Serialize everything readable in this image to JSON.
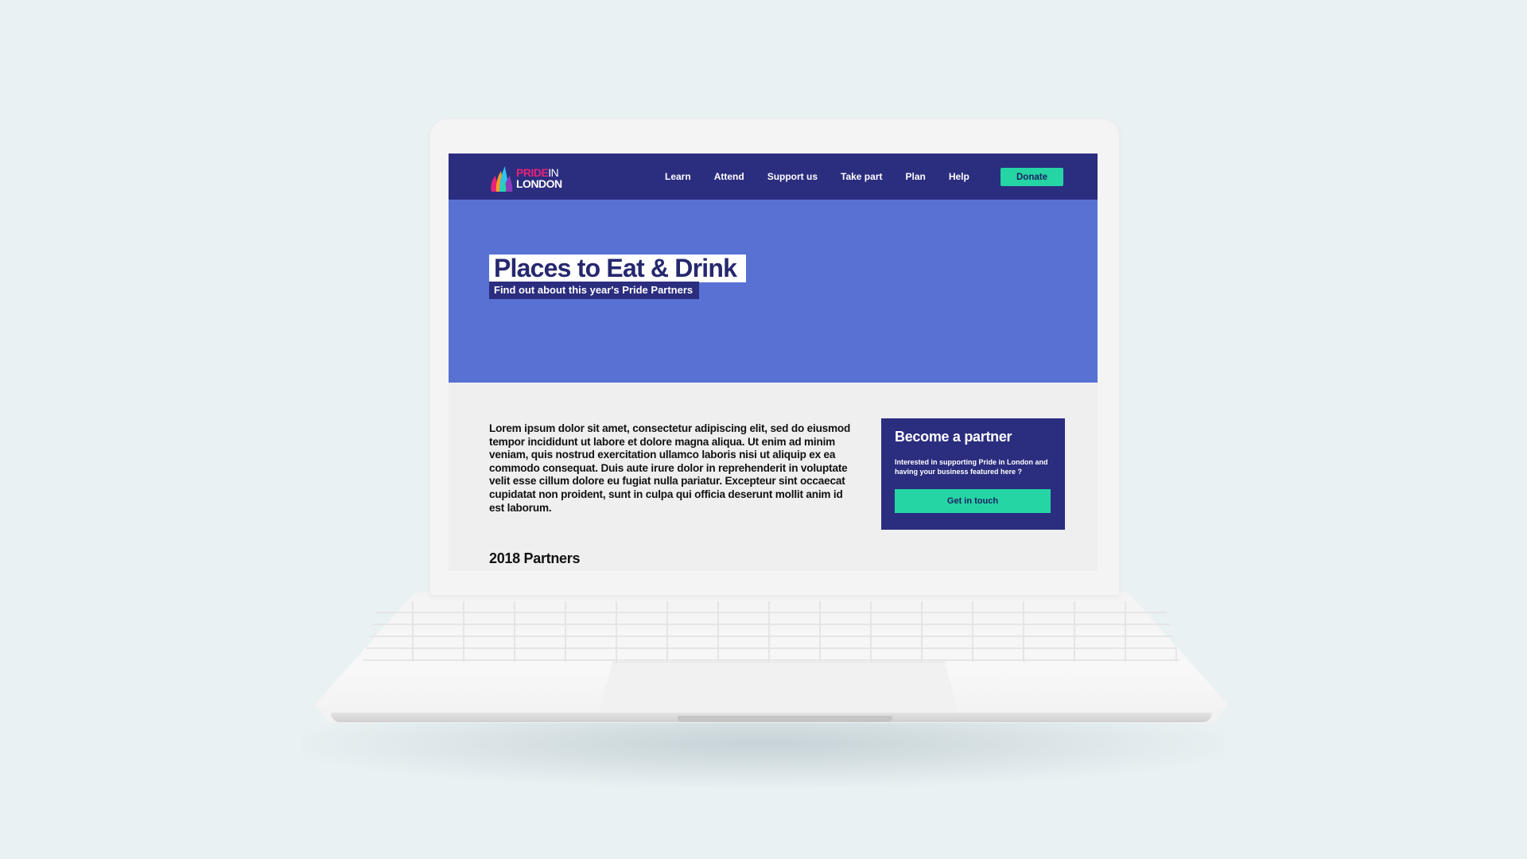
{
  "nav": {
    "logo": {
      "pride": "PRIDE",
      "in": "IN",
      "london": "LONDON"
    },
    "links": [
      "Learn",
      "Attend",
      "Support us",
      "Take part",
      "Plan",
      "Help"
    ],
    "donate_label": "Donate"
  },
  "hero": {
    "title": "Places to Eat & Drink",
    "subtitle": "Find out about this year's Pride Partners"
  },
  "content": {
    "body": "Lorem ipsum dolor sit amet, consectetur adipiscing elit, sed do eiusmod tempor incididunt ut labore et dolore magna aliqua. Ut enim ad minim veniam, quis nostrud exercitation ullamco laboris nisi ut aliquip ex ea commodo consequat. Duis aute irure dolor in reprehenderit in voluptate velit esse cillum dolore eu fugiat nulla pariatur. Excepteur sint occaecat cupidatat non proident, sunt in culpa qui officia deserunt mollit anim id est laborum.",
    "partners_heading": "2018 Partners"
  },
  "partner_card": {
    "title": "Become a partner",
    "text": "Interested in supporting Pride in London and having your business featured here ?",
    "button_label": "Get in touch"
  },
  "colors": {
    "navy": "#2b2d7f",
    "hero_blue": "#5871d3",
    "accent_green": "#25d5a4",
    "logo_pink": "#e6237a",
    "page_bg": "#efefef",
    "backdrop": "#e9f1f3"
  },
  "icons": [
    "pride-flames-logo-icon"
  ]
}
